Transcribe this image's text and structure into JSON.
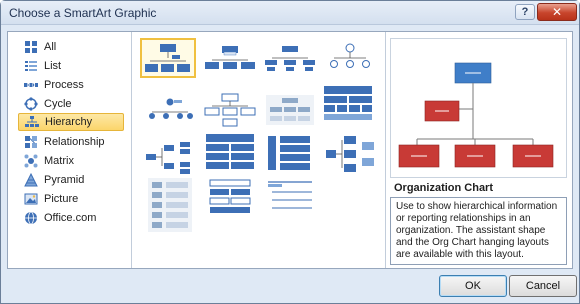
{
  "window": {
    "title": "Choose a SmartArt Graphic",
    "help_label": "?",
    "close_label": "✕"
  },
  "categories": [
    {
      "label": "All",
      "icon": "grid-icon",
      "selected": false
    },
    {
      "label": "List",
      "icon": "list-icon",
      "selected": false
    },
    {
      "label": "Process",
      "icon": "process-icon",
      "selected": false
    },
    {
      "label": "Cycle",
      "icon": "cycle-icon",
      "selected": false
    },
    {
      "label": "Hierarchy",
      "icon": "hierarchy-icon",
      "selected": true
    },
    {
      "label": "Relationship",
      "icon": "relationship-icon",
      "selected": false
    },
    {
      "label": "Matrix",
      "icon": "matrix-icon",
      "selected": false
    },
    {
      "label": "Pyramid",
      "icon": "pyramid-icon",
      "selected": false
    },
    {
      "label": "Picture",
      "icon": "picture-icon",
      "selected": false
    },
    {
      "label": "Office.com",
      "icon": "office-icon",
      "selected": false
    }
  ],
  "preview": {
    "title": "Organization Chart",
    "description": "Use to show hierarchical information or reporting relationships in an organization. The assistant shape and the Org Chart hanging layouts are available with this layout."
  },
  "buttons": {
    "ok": "OK",
    "cancel": "Cancel"
  },
  "colors": {
    "accent_blue": "#3d6fb6",
    "preview_blue": "#3f7ec8",
    "preview_red": "#c83a36",
    "selection": "#fbd56b"
  }
}
